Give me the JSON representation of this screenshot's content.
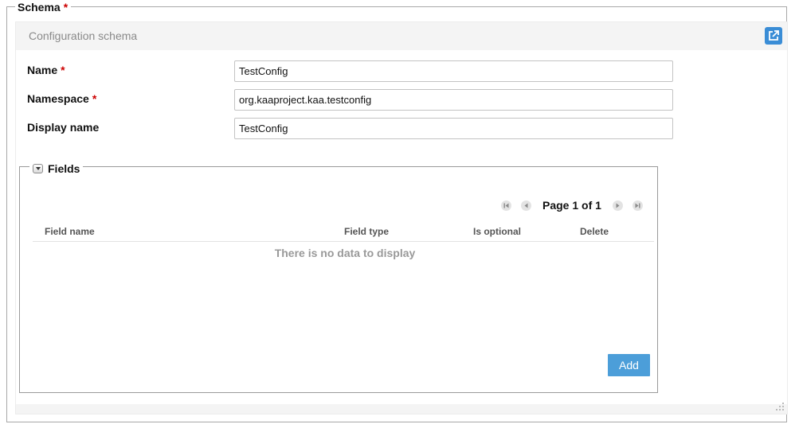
{
  "schema": {
    "legend": "Schema",
    "required_mark": "*",
    "panel_title": "Configuration schema",
    "open_icon": "external-link-icon",
    "accent_color": "#3a8dd6"
  },
  "form": {
    "name": {
      "label": "Name",
      "required_mark": "*",
      "value": "TestConfig"
    },
    "namespace": {
      "label": "Namespace",
      "required_mark": "*",
      "value": "org.kaaproject.kaa.testconfig"
    },
    "display_name": {
      "label": "Display name",
      "value": "TestConfig"
    }
  },
  "fields": {
    "legend": "Fields",
    "pager": {
      "text": "Page 1 of 1"
    },
    "columns": [
      "Field name",
      "Field type",
      "Is optional",
      "Delete"
    ],
    "empty_message": "There is no data to display",
    "add_label": "Add",
    "add_color": "#4c9ed9"
  }
}
